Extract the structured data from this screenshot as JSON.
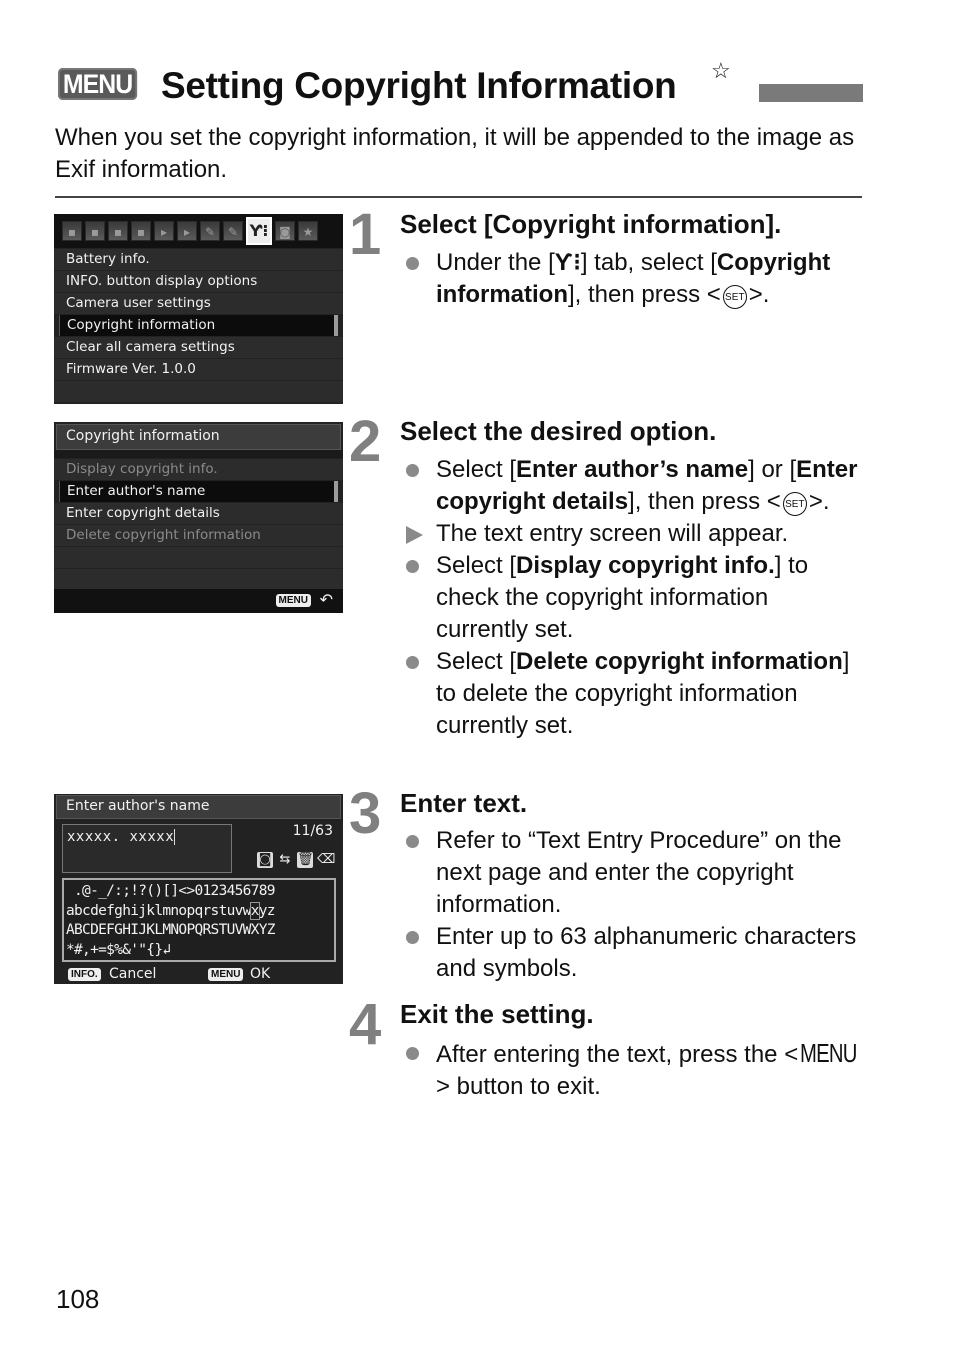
{
  "header": {
    "menu_badge": "MENU",
    "title": "Setting Copyright Information",
    "star": "☆",
    "intro": "When you set the copyright information, it will be appended to the image as Exif information."
  },
  "screen1": {
    "tabs": [
      {
        "icon": "shooting-1-icon",
        "glyph": "▪"
      },
      {
        "icon": "shooting-2-icon",
        "glyph": "▪"
      },
      {
        "icon": "shooting-3-icon",
        "glyph": "▪"
      },
      {
        "icon": "shooting-4-icon",
        "glyph": "▪"
      },
      {
        "icon": "playback-1-icon",
        "glyph": "▸"
      },
      {
        "icon": "playback-2-icon",
        "glyph": "▸"
      },
      {
        "icon": "setup-1-icon",
        "glyph": "✎"
      },
      {
        "icon": "setup-2-icon",
        "glyph": "✎"
      },
      {
        "icon": "setup-3-icon",
        "glyph": "Ƴ⁝",
        "active": true
      },
      {
        "icon": "custom-functions-icon",
        "glyph": "◙"
      },
      {
        "icon": "my-menu-icon",
        "glyph": "★"
      }
    ],
    "items": [
      {
        "label": "Battery info."
      },
      {
        "label": "INFO. button display options"
      },
      {
        "label": "Camera user settings"
      },
      {
        "label": "Copyright information",
        "selected": true
      },
      {
        "label": "Clear all camera settings"
      },
      {
        "label": "Firmware Ver. 1.0.0"
      }
    ]
  },
  "screen2": {
    "title": "Copyright information",
    "items": [
      {
        "label": "Display copyright info.",
        "disabled": true
      },
      {
        "label": "Enter author's name",
        "selected": true
      },
      {
        "label": "Enter copyright details"
      },
      {
        "label": "Delete copyright information",
        "disabled": true
      }
    ],
    "footer_menu": "MENU",
    "footer_back": "↶"
  },
  "screen3": {
    "title": "Enter author's name",
    "input_value": "xxxxx. xxxxx",
    "count": "11/63",
    "palette": {
      "row1": " .@-_/:;!?()[]<>0123456789",
      "row2_before": "abcdefghijklmnopqrstuvw",
      "row2_highlight": "x",
      "row2_after": "yz",
      "row3": "ABCDEFGHIJKLMNOPQRSTUVWXYZ",
      "row4": "*#,+=$%&'\"{}↲"
    },
    "info_key": "INFO.",
    "cancel": "Cancel",
    "menu_key": "MENU",
    "ok": "OK"
  },
  "steps": [
    {
      "number": "1",
      "title": "Select [Copyright information].",
      "b1_pre": "Under the [",
      "b1_tab": "Ƴ⁝",
      "b1_mid": "] tab, select [",
      "b1_bold": "Copyright information",
      "b1_post": "], then press <",
      "set": "SET",
      "b1_end": ">."
    },
    {
      "number": "2",
      "title": "Select the desired option.",
      "b1_pre": "Select [",
      "b1_bold1": "Enter author’s name",
      "b1_mid": "] or [",
      "b1_bold2": "Enter copyright details",
      "b1_post": "], then press <",
      "set": "SET",
      "b1_end": ">.",
      "result": "The text entry screen will appear.",
      "b2_pre": "Select [",
      "b2_bold": "Display copyright info.",
      "b2_post": "] to check the copyright information currently set.",
      "b3_pre": "Select [",
      "b3_bold": "Delete copyright information",
      "b3_post": "] to delete the copyright information currently set."
    },
    {
      "number": "3",
      "title": "Enter text.",
      "b1": "Refer to “Text Entry Procedure” on the next page and enter the copyright information.",
      "b2": "Enter up to 63 alphanumeric characters and symbols."
    },
    {
      "number": "4",
      "title": "Exit the setting.",
      "b1_pre": "After entering the text, press the <",
      "b1_menu": "MENU",
      "b1_post": "> button to exit."
    }
  ],
  "page_number": "108"
}
